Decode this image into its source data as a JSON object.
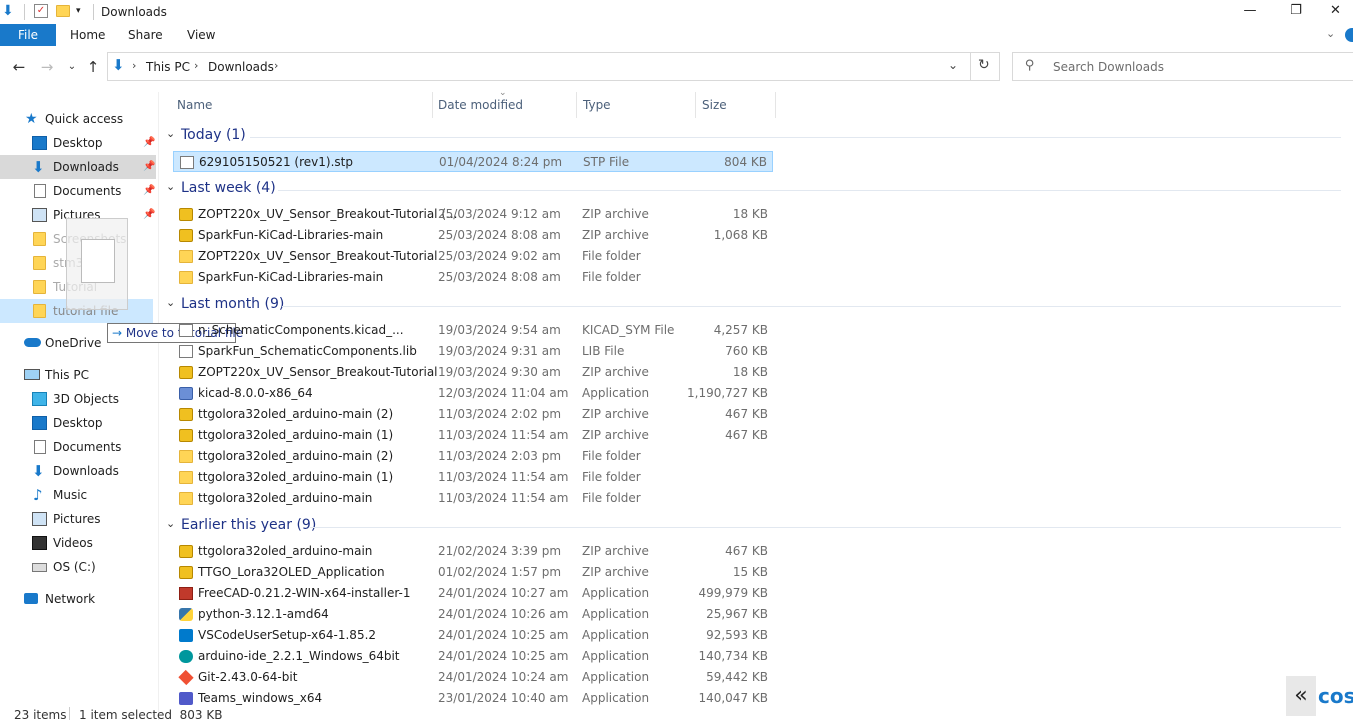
{
  "window": {
    "title": "Downloads",
    "min": "—",
    "restore": "❐",
    "close": "✕"
  },
  "ribbon": {
    "file": "File",
    "tabs": [
      "Home",
      "Share",
      "View"
    ]
  },
  "address": {
    "path": [
      "This PC",
      "Downloads"
    ],
    "sep": "›",
    "search_placeholder": "Search Downloads"
  },
  "nav": {
    "quick_access": "Quick access",
    "quick_items": [
      {
        "label": "Desktop",
        "pinned": true
      },
      {
        "label": "Downloads",
        "pinned": true
      },
      {
        "label": "Documents",
        "pinned": true
      },
      {
        "label": "Pictures",
        "pinned": true
      },
      {
        "label": "Screenshots",
        "pinned": false
      },
      {
        "label": "stm32test",
        "pinned": false
      },
      {
        "label": "Tutorial",
        "pinned": false
      },
      {
        "label": "tutorial file",
        "pinned": false
      }
    ],
    "onedrive": "OneDrive",
    "this_pc": "This PC",
    "pc_items": [
      "3D Objects",
      "Desktop",
      "Documents",
      "Downloads",
      "Music",
      "Pictures",
      "Videos",
      "OS (C:)"
    ],
    "network": "Network"
  },
  "columns": {
    "name": "Name",
    "date": "Date modified",
    "type": "Type",
    "size": "Size"
  },
  "groups": [
    {
      "label": "Today (1)",
      "rows": [
        {
          "name": "629105150521 (rev1).stp",
          "date": "01/04/2024 8:24 pm",
          "type": "STP File",
          "size": "804 KB",
          "icon": "file",
          "selected": true
        }
      ]
    },
    {
      "label": "Last week (4)",
      "rows": [
        {
          "name": "ZOPT220x_UV_Sensor_Breakout-Tutorial (...",
          "date": "25/03/2024 9:12 am",
          "type": "ZIP archive",
          "size": "18 KB",
          "icon": "zip"
        },
        {
          "name": "SparkFun-KiCad-Libraries-main",
          "date": "25/03/2024 8:08 am",
          "type": "ZIP archive",
          "size": "1,068 KB",
          "icon": "zip"
        },
        {
          "name": "ZOPT220x_UV_Sensor_Breakout-Tutorial",
          "date": "25/03/2024 9:02 am",
          "type": "File folder",
          "size": "",
          "icon": "folder"
        },
        {
          "name": "SparkFun-KiCad-Libraries-main",
          "date": "25/03/2024 8:08 am",
          "type": "File folder",
          "size": "",
          "icon": "folder"
        }
      ]
    },
    {
      "label": "Last month (9)",
      "rows": [
        {
          "name": "n_SchematicComponents.kicad_...",
          "date": "19/03/2024 9:54 am",
          "type": "KICAD_SYM File",
          "size": "4,257 KB",
          "icon": "file"
        },
        {
          "name": "SparkFun_SchematicComponents.lib",
          "date": "19/03/2024 9:31 am",
          "type": "LIB File",
          "size": "760 KB",
          "icon": "file"
        },
        {
          "name": "ZOPT220x_UV_Sensor_Breakout-Tutorial",
          "date": "19/03/2024 9:30 am",
          "type": "ZIP archive",
          "size": "18 KB",
          "icon": "zip"
        },
        {
          "name": "kicad-8.0.0-x86_64",
          "date": "12/03/2024 11:04 am",
          "type": "Application",
          "size": "1,190,727 KB",
          "icon": "app"
        },
        {
          "name": "ttgolora32oled_arduino-main (2)",
          "date": "11/03/2024 2:02 pm",
          "type": "ZIP archive",
          "size": "467 KB",
          "icon": "zip"
        },
        {
          "name": "ttgolora32oled_arduino-main (1)",
          "date": "11/03/2024 11:54 am",
          "type": "ZIP archive",
          "size": "467 KB",
          "icon": "zip"
        },
        {
          "name": "ttgolora32oled_arduino-main (2)",
          "date": "11/03/2024 2:03 pm",
          "type": "File folder",
          "size": "",
          "icon": "folder"
        },
        {
          "name": "ttgolora32oled_arduino-main (1)",
          "date": "11/03/2024 11:54 am",
          "type": "File folder",
          "size": "",
          "icon": "folder"
        },
        {
          "name": "ttgolora32oled_arduino-main",
          "date": "11/03/2024 11:54 am",
          "type": "File folder",
          "size": "",
          "icon": "folder"
        }
      ]
    },
    {
      "label": "Earlier this year (9)",
      "rows": [
        {
          "name": "ttgolora32oled_arduino-main",
          "date": "21/02/2024 3:39 pm",
          "type": "ZIP archive",
          "size": "467 KB",
          "icon": "zip"
        },
        {
          "name": "TTGO_Lora32OLED_Application",
          "date": "01/02/2024 1:57 pm",
          "type": "ZIP archive",
          "size": "15 KB",
          "icon": "zip"
        },
        {
          "name": "FreeCAD-0.21.2-WIN-x64-installer-1",
          "date": "24/01/2024 10:27 am",
          "type": "Application",
          "size": "499,979 KB",
          "icon": "app"
        },
        {
          "name": "python-3.12.1-amd64",
          "date": "24/01/2024 10:26 am",
          "type": "Application",
          "size": "25,967 KB",
          "icon": "app"
        },
        {
          "name": "VSCodeUserSetup-x64-1.85.2",
          "date": "24/01/2024 10:25 am",
          "type": "Application",
          "size": "92,593 KB",
          "icon": "app"
        },
        {
          "name": "arduino-ide_2.2.1_Windows_64bit",
          "date": "24/01/2024 10:25 am",
          "type": "Application",
          "size": "140,734 KB",
          "icon": "app"
        },
        {
          "name": "Git-2.43.0-64-bit",
          "date": "24/01/2024 10:24 am",
          "type": "Application",
          "size": "59,442 KB",
          "icon": "app"
        },
        {
          "name": "Teams_windows_x64",
          "date": "23/01/2024 10:40 am",
          "type": "Application",
          "size": "140,047 KB",
          "icon": "app"
        }
      ]
    }
  ],
  "tooltip": "Move to tutorial file",
  "status": {
    "items": "23 items",
    "selected": "1 item selected  803 KB"
  },
  "corner": {
    "chevrons": "«",
    "logo": "cos"
  },
  "colors": {
    "accent": "#1979ca",
    "selection": "#cce8ff",
    "group_text": "#1e3287"
  }
}
